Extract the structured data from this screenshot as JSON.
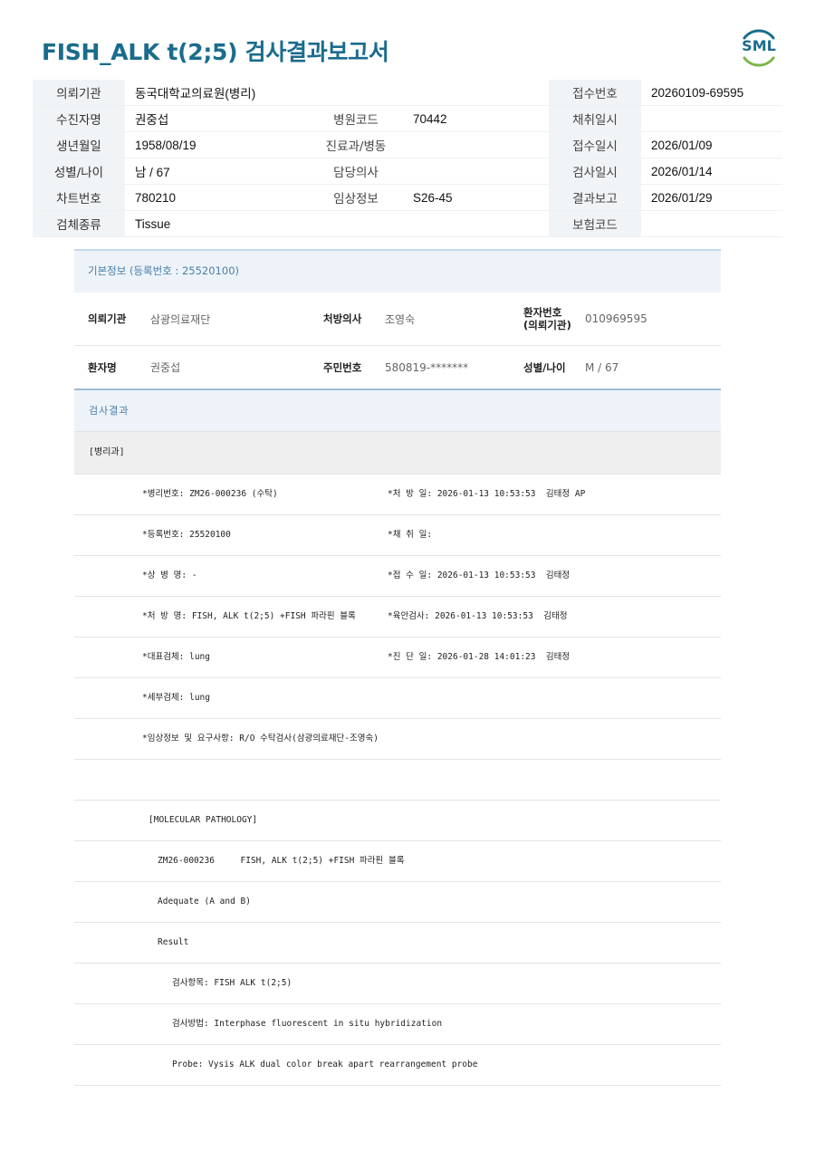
{
  "header": {
    "title": "FISH_ALK t(2;5) 검사결과보고서",
    "logo_text": "SML"
  },
  "patient_table": {
    "rows": [
      {
        "l1": "의뢰기관",
        "v1": "동국대학교의료원(병리)",
        "l2": "",
        "v2": "",
        "l3": "접수번호",
        "v3": "20260109-69595"
      },
      {
        "l1": "수진자명",
        "v1": "권중섭",
        "l2": "병원코드",
        "v2": "70442",
        "l3": "채취일시",
        "v3": ""
      },
      {
        "l1": "생년월일",
        "v1": "1958/08/19",
        "l2": "진료과/병동",
        "v2": "",
        "l3": "접수일시",
        "v3": "2026/01/09"
      },
      {
        "l1": "성별/나이",
        "v1": "남 / 67",
        "l2": "담당의사",
        "v2": "",
        "l3": "검사일시",
        "v3": "2026/01/14"
      },
      {
        "l1": "차트번호",
        "v1": "780210",
        "l2": "임상정보",
        "v2": "S26-45",
        "l3": "결과보고",
        "v3": "2026/01/29"
      },
      {
        "l1": "검체종류",
        "v1": "Tissue",
        "l2": "",
        "v2": "",
        "l3": "보험코드",
        "v3": ""
      }
    ]
  },
  "basic_info": {
    "heading": "기본정보",
    "reg_no": "(등록번호 : 25520100)",
    "row1": {
      "k1": "의뢰기관",
      "v1": "삼광의료재단",
      "k2": "처방의사",
      "v2": "조영숙",
      "k3a": "환자번호",
      "k3b": "(의뢰기관)",
      "v3": "010969595"
    },
    "row2": {
      "k1": "환자명",
      "v1": "권중섭",
      "k2": "주민번호",
      "v2": "580819-*******",
      "k3": "성별/나이",
      "v3": "M / 67"
    }
  },
  "results": {
    "heading": "검사결과",
    "section": "[병리과]",
    "lines": [
      {
        "a": "*병리번호: ZM26-000236 (수탁)",
        "b": "*처 방 일: 2026-01-13 10:53:53  김태정 AP"
      },
      {
        "a": "*등록번호: 25520100",
        "b": "*채 취 일:"
      },
      {
        "a": "*상 병 명: -",
        "b": "*접 수 일: 2026-01-13 10:53:53  김태정"
      },
      {
        "a": "*처 방 명: FISH, ALK t(2;5) +FISH 파라핀 블록",
        "b": "*육안검사: 2026-01-13 10:53:53  김태정"
      },
      {
        "a": "*대표검체: lung",
        "b": "*진 단 일: 2026-01-28 14:01:23  김태정"
      },
      {
        "a": "*세부검체: lung",
        "b": ""
      },
      {
        "a": "*임상정보 및 요구사항: R/O 수탁검사(삼광의료재단-조영숙)",
        "b": ""
      },
      {
        "a": "",
        "b": ""
      },
      {
        "a": "[MOLECULAR PATHOLOGY]",
        "b": ""
      },
      {
        "a": "ZM26-000236     FISH, ALK t(2;5) +FISH 파라핀 블록",
        "b": ""
      },
      {
        "a": "Adequate (A and B)",
        "b": ""
      },
      {
        "a": "Result",
        "b": ""
      },
      {
        "a": "검사항목: FISH ALK t(2;5)",
        "b": ""
      },
      {
        "a": "검사방법: Interphase fluorescent in situ hybridization",
        "b": ""
      },
      {
        "a": "Probe: Vysis ALK dual color break apart rearrangement probe",
        "b": ""
      }
    ]
  }
}
